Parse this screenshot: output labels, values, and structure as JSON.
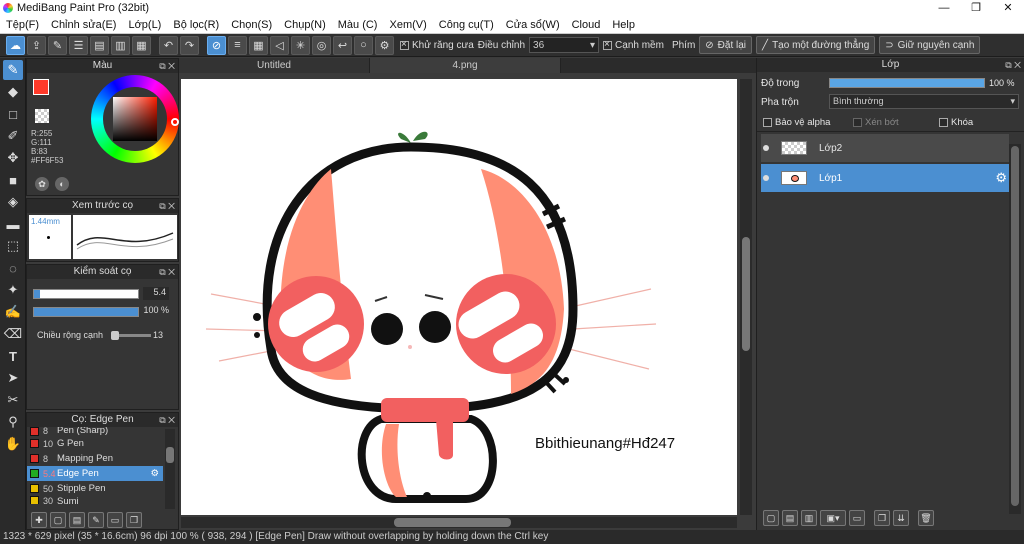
{
  "window": {
    "title": "MediBang Paint Pro (32bit)",
    "min": "—",
    "max": "❐",
    "close": "✕"
  },
  "menu": [
    "Tệp(F)",
    "Chỉnh sửa(E)",
    "Lớp(L)",
    "Bộ lọc(R)",
    "Chọn(S)",
    "Chụp(N)",
    "Màu (C)",
    "Xem(V)",
    "Công cụ(T)",
    "Cửa sổ(W)",
    "Cloud",
    "Help"
  ],
  "toolbar": {
    "antialias_label": "Khử răng cưa",
    "adjust_label": "Điều chỉnh",
    "adjust_value": "36",
    "soft_edge_label": "Cạnh mềm",
    "key_label": "Phím",
    "reset_label": "Đặt lại",
    "straight_line_label": "Tạo một đường thẳng",
    "keep_edge_label": "Giữ nguyên cạnh"
  },
  "color_panel": {
    "title": "Màu",
    "r": "R:255",
    "g": "G:111",
    "b": "B:83",
    "hex": "#FF6F53",
    "primary": "#ff3a2a"
  },
  "preview_panel": {
    "title": "Xem trước cọ",
    "size": "1.44mm"
  },
  "brush_control": {
    "title": "Kiểm soát cọ",
    "size_value": "5.4",
    "opacity_value": "100 %",
    "edge_width_label": "Chiều rộng cạnh",
    "edge_width_value": "13"
  },
  "brush_list": {
    "title": "Cọ: Edge Pen",
    "items": [
      {
        "num": "8",
        "name": "Pen (Sharp)",
        "color": "#e0302a"
      },
      {
        "num": "10",
        "name": "G Pen",
        "color": "#e0302a"
      },
      {
        "num": "8",
        "name": "Mapping Pen",
        "color": "#e0302a"
      },
      {
        "num": "5.4",
        "name": "Edge Pen",
        "color": "#22aa22",
        "selected": true
      },
      {
        "num": "50",
        "name": "Stipple Pen",
        "color": "#e8c000"
      },
      {
        "num": "30",
        "name": "Sumi",
        "color": "#e8c000"
      }
    ]
  },
  "tabs": [
    "Untitled",
    "4.png"
  ],
  "canvas": {
    "signature": "Bbithieunang#Hđ247"
  },
  "layer_panel": {
    "title": "Lớp",
    "opacity_label": "Độ trong",
    "opacity_value": "100 %",
    "blend_label": "Pha trộn",
    "blend_value": "Bình thường",
    "protect_alpha": "Bảo vệ alpha",
    "clipping": "Xén bớt",
    "lock": "Khóa",
    "layers": [
      {
        "name": "Lớp2",
        "selected": false
      },
      {
        "name": "Lớp1",
        "selected": true
      }
    ]
  },
  "status": {
    "text": "1323 * 629 pixel  (35 * 16.6cm)  96 dpi  100 %  ( 938, 294 )  [Edge Pen] Draw without overlapping by holding down the Ctrl key"
  },
  "accent": "#4b8fd1"
}
